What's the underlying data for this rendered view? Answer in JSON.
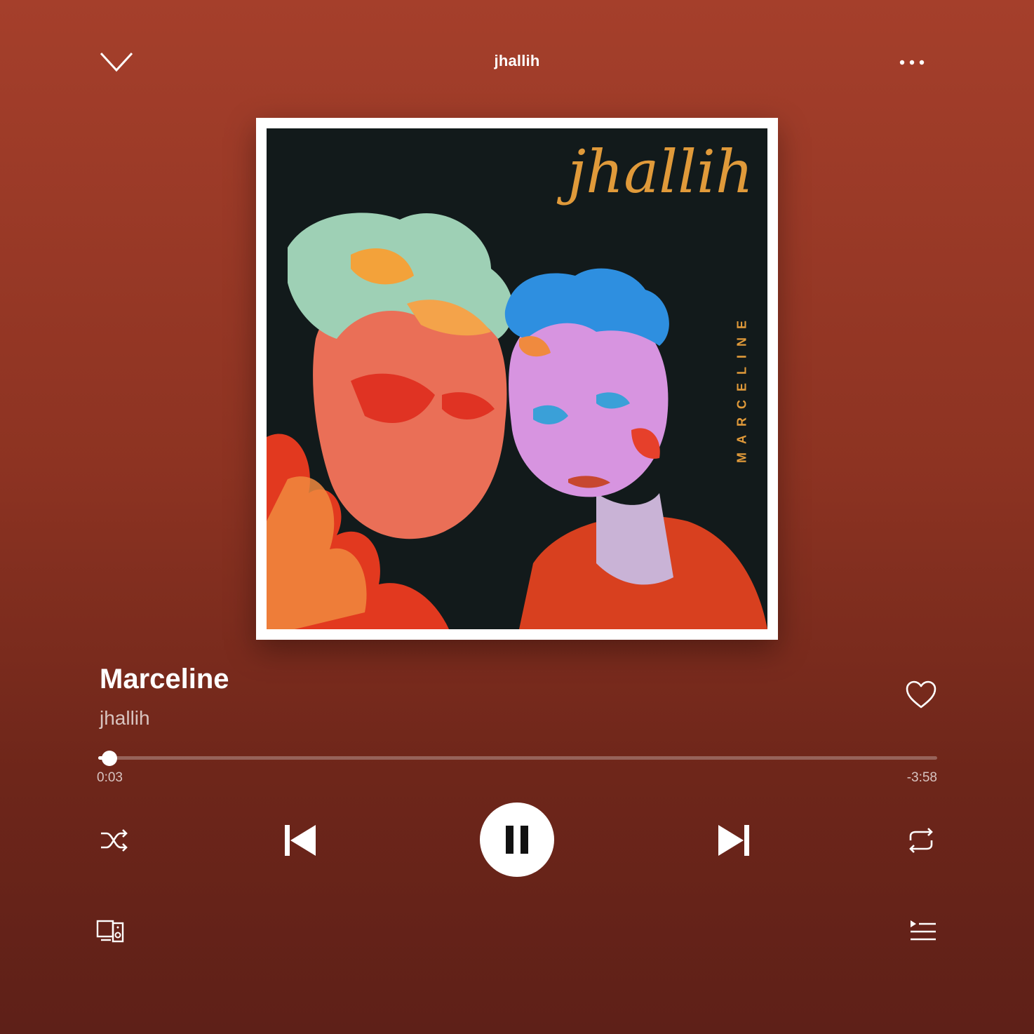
{
  "header": {
    "context_title": "jhallih",
    "collapse_icon": "chevron-down-icon",
    "more_icon": "more-options-icon"
  },
  "album_art": {
    "artist_script": "jhallih",
    "vertical_title": "MARCELINE",
    "accent_color": "#e09a3a"
  },
  "track": {
    "title": "Marceline",
    "artist": "jhallih",
    "liked": false
  },
  "progress": {
    "elapsed": "0:03",
    "remaining": "-3:58",
    "fraction": 0.013
  },
  "controls": {
    "shuffle_icon": "shuffle-icon",
    "previous_icon": "skip-previous-icon",
    "play_state_icon": "pause-icon",
    "next_icon": "skip-next-icon",
    "repeat_icon": "repeat-icon",
    "devices_icon": "connect-devices-icon",
    "queue_icon": "queue-icon"
  },
  "colors": {
    "background_top": "#a53f2b",
    "background_bottom": "#5e2018",
    "foreground": "#ffffff"
  }
}
